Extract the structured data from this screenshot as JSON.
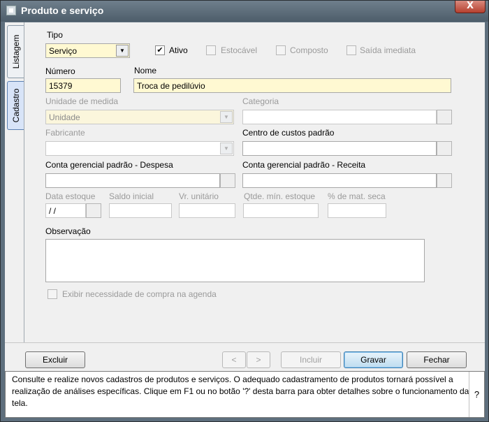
{
  "window": {
    "title": "Produto e serviço",
    "close_label": "X"
  },
  "tabs": [
    {
      "label": "Listagem"
    },
    {
      "label": "Cadastro"
    }
  ],
  "form": {
    "tipo": {
      "label": "Tipo",
      "value": "Serviço"
    },
    "ativo": {
      "label": "Ativo",
      "checked": true
    },
    "estocavel": {
      "label": "Estocável",
      "checked": false
    },
    "composto": {
      "label": "Composto",
      "checked": false
    },
    "saida_imediata": {
      "label": "Saída imediata",
      "checked": false
    },
    "numero": {
      "label": "Número",
      "value": "15379"
    },
    "nome": {
      "label": "Nome",
      "value": "Troca de pedilúvio"
    },
    "unidade_medida": {
      "label": "Unidade de medida",
      "value": "Unidade"
    },
    "categoria": {
      "label": "Categoria",
      "value": ""
    },
    "fabricante": {
      "label": "Fabricante",
      "value": ""
    },
    "centro_custos": {
      "label": "Centro de custos padrão",
      "value": ""
    },
    "conta_despesa": {
      "label": "Conta gerencial padrão - Despesa",
      "value": ""
    },
    "conta_receita": {
      "label": "Conta gerencial padrão - Receita",
      "value": ""
    },
    "data_estoque": {
      "label": "Data estoque",
      "value": " / /"
    },
    "saldo_inicial": {
      "label": "Saldo inicial",
      "value": ""
    },
    "vr_unitario": {
      "label": "Vr. unitário",
      "value": ""
    },
    "qtde_min": {
      "label": "Qtde. mín. estoque",
      "value": ""
    },
    "mat_seca": {
      "label": "% de mat. seca",
      "value": ""
    },
    "observacao": {
      "label": "Observação",
      "value": ""
    },
    "exibir_necessidade": {
      "label": "Exibir necessidade de compra na agenda",
      "checked": false
    }
  },
  "buttons": {
    "excluir": "Excluir",
    "prev": "<",
    "next": ">",
    "incluir": "Incluir",
    "gravar": "Gravar",
    "fechar": "Fechar"
  },
  "help": {
    "text": "Consulte e realize novos cadastros de produtos e serviços. O adequado cadastramento de produtos tornará possível a realização de análises específicas. Clique em F1 ou no botão '?' desta barra para obter detalhes sobre o funcionamento da tela.",
    "button": "?"
  }
}
